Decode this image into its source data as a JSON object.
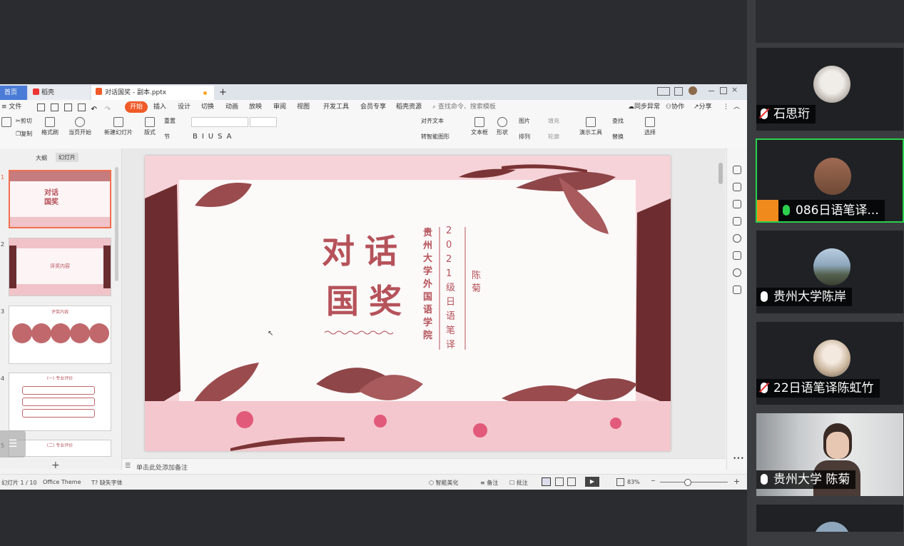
{
  "window": {
    "tabs": [
      {
        "label": "首页"
      },
      {
        "label": "稻壳"
      },
      {
        "label": "对话国奖 - 副本.pptx"
      }
    ],
    "new_tab": "+"
  },
  "menu": {
    "items": [
      "文件",
      "开始",
      "插入",
      "设计",
      "切换",
      "动画",
      "放映",
      "审阅",
      "视图",
      "开发工具",
      "会员专享",
      "稻壳资源"
    ],
    "search_placeholder": "查找命令、搜索模板",
    "right": [
      "同步异常",
      "协作",
      "分享"
    ]
  },
  "ribbon": {
    "items": [
      "剪切",
      "复制",
      "格式刷",
      "当页开始",
      "新建幻灯片",
      "版式",
      "节",
      "重置",
      "对齐文本",
      "转智能图形",
      "文本框",
      "形状",
      "图片",
      "排列",
      "填充",
      "轮廓",
      "演示工具",
      "查找",
      "替换",
      "选择"
    ]
  },
  "left_panel": {
    "tabs": [
      "大纲",
      "幻灯片"
    ],
    "thumb_numbers": [
      "1",
      "2",
      "3",
      "4",
      "5"
    ],
    "thumb_titles": [
      "对话国奖",
      "评奖内容",
      "评奖内容",
      "(一) 专业评价",
      "(二) 专业评价"
    ]
  },
  "slide": {
    "title_line1": "对话",
    "title_line2": "国奖",
    "school": "贵州大学外国语学院",
    "class": "2021级日语笔译",
    "name": "陈菊"
  },
  "notes": {
    "placeholder": "单击此处添加备注"
  },
  "status": {
    "slide_counter": "幻灯片 1 / 10",
    "theme": "Office Theme",
    "missing_font": "缺失字体",
    "smart_beautify": "智能美化",
    "notes": "备注",
    "comments": "批注",
    "zoom": "83%"
  },
  "participants": [
    {
      "name": "石思珩",
      "mic": "muted"
    },
    {
      "name": "086日语笔译...",
      "mic": "active",
      "host": true
    },
    {
      "name": "贵州大学陈岸",
      "mic": "on"
    },
    {
      "name": "22日语笔译陈虹竹",
      "mic": "muted"
    },
    {
      "name": "贵州大学 陈菊",
      "mic": "on"
    }
  ],
  "colors": {
    "accent_orange": "#f05a28",
    "slide_text": "#b5525a",
    "speaking_border": "#2bd04d",
    "background": "#2a2c30"
  }
}
